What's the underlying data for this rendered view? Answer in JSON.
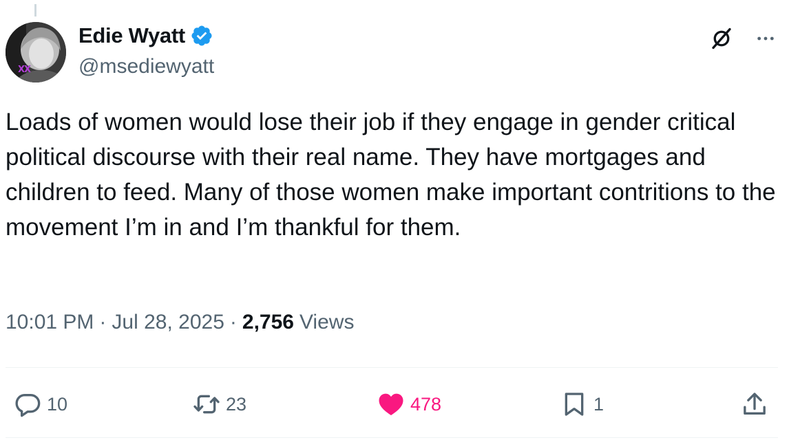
{
  "author": {
    "display_name": "Edie Wyatt",
    "handle": "@msediewyatt",
    "verified": true,
    "avatar_badge": "XX"
  },
  "tweet": {
    "text": "Loads of women would lose their job if they engage in gender critical political discourse with their real name. They have mortgages and children to feed. Many of those women make important contritions to the movement I’m in and I’m thankful for them.",
    "time": "10:01 PM",
    "separator": "·",
    "date": "Jul 28, 2025",
    "views_count": "2,756",
    "views_label": "Views"
  },
  "icons": {
    "verified": "verified-badge-icon",
    "grok": "grok-icon",
    "more": "more-icon",
    "reply": "reply-icon",
    "repost": "repost-icon",
    "like": "heart-icon",
    "bookmark": "bookmark-icon",
    "share": "share-icon"
  },
  "actions": {
    "replies": "10",
    "reposts": "23",
    "likes": "478",
    "bookmarks": "1",
    "liked": true
  },
  "colors": {
    "text": "#0f1419",
    "secondary": "#536471",
    "verified": "#1d9bf0",
    "like": "#f91880",
    "divider": "#eff3f4"
  }
}
